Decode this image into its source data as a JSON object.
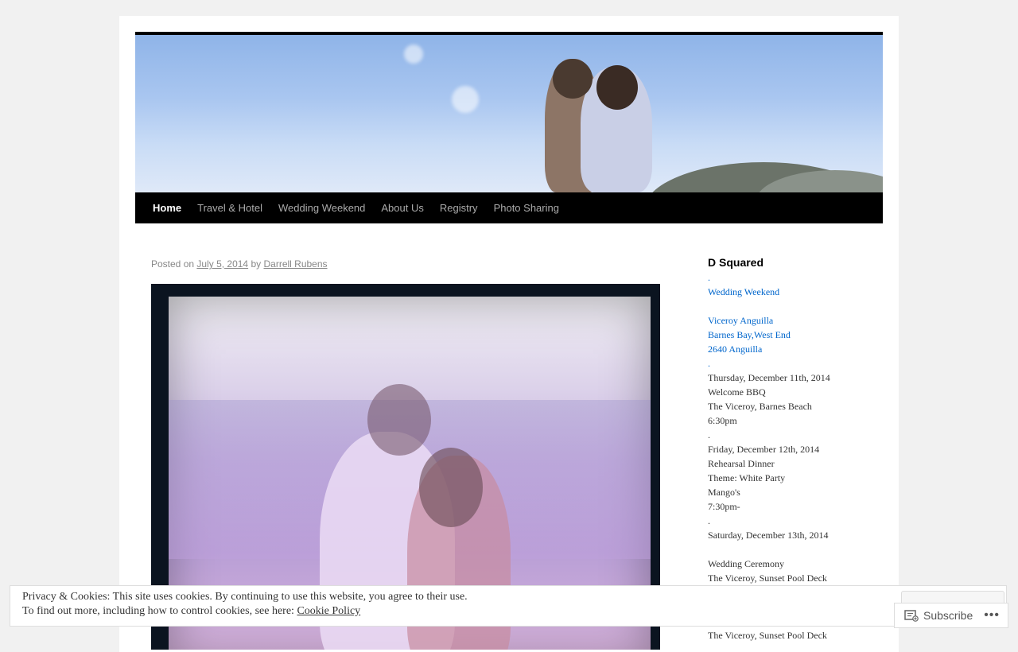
{
  "nav": {
    "items": [
      {
        "label": "Home"
      },
      {
        "label": "Travel & Hotel"
      },
      {
        "label": "Wedding Weekend"
      },
      {
        "label": "About Us"
      },
      {
        "label": "Registry"
      },
      {
        "label": "Photo Sharing"
      }
    ],
    "current": "Home"
  },
  "post": {
    "posted_on": "Posted on",
    "date": "July 5, 2014",
    "by": "by",
    "author": "Darrell Rubens"
  },
  "sidebar": {
    "title": "D Squared",
    "lines": [
      {
        "text": ".",
        "link": true
      },
      {
        "text": "Wedding Weekend",
        "link": true
      },
      {
        "text": "",
        "link": false
      },
      {
        "text": "Viceroy Anguilla",
        "link": true
      },
      {
        "text": "Barnes Bay,West End",
        "link": true
      },
      {
        "text": "2640 Anguilla",
        "link": true
      },
      {
        "text": ".",
        "link": true
      },
      {
        "text": "Thursday, December 11th, 2014",
        "link": false
      },
      {
        "text": "Welcome BBQ",
        "link": false
      },
      {
        "text": "The Viceroy, Barnes Beach",
        "link": false
      },
      {
        "text": "6:30pm",
        "link": false
      },
      {
        "text": ".",
        "link": false
      },
      {
        "text": "Friday, December 12th, 2014",
        "link": false
      },
      {
        "text": "Rehearsal Dinner",
        "link": false
      },
      {
        "text": "Theme: White Party",
        "link": false
      },
      {
        "text": "Mango's",
        "link": false
      },
      {
        "text": "7:30pm-",
        "link": false
      },
      {
        "text": ".",
        "link": false
      },
      {
        "text": "Saturday, December 13th, 2014",
        "link": false
      },
      {
        "text": "",
        "link": false
      },
      {
        "text": "Wedding Ceremony",
        "link": false
      },
      {
        "text": "The Viceroy, Sunset Pool Deck",
        "link": false
      },
      {
        "text": "",
        "link": false
      },
      {
        "text": "",
        "link": false
      },
      {
        "text": "",
        "link": false
      },
      {
        "text": "The Viceroy, Sunset Pool Deck",
        "link": false
      }
    ]
  },
  "cookie": {
    "line1": "Privacy & Cookies: This site uses cookies. By continuing to use this website, you agree to their use.",
    "line2": "To find out more, including how to control cookies, see here:",
    "link": "Cookie Policy"
  },
  "subscribe": {
    "label": "Subscribe",
    "more": "•••",
    "icon": "reader-follow-icon"
  },
  "colors": {
    "link": "#0066cc",
    "nav_bg": "#000000",
    "page_bg": "#f1f1f1"
  }
}
